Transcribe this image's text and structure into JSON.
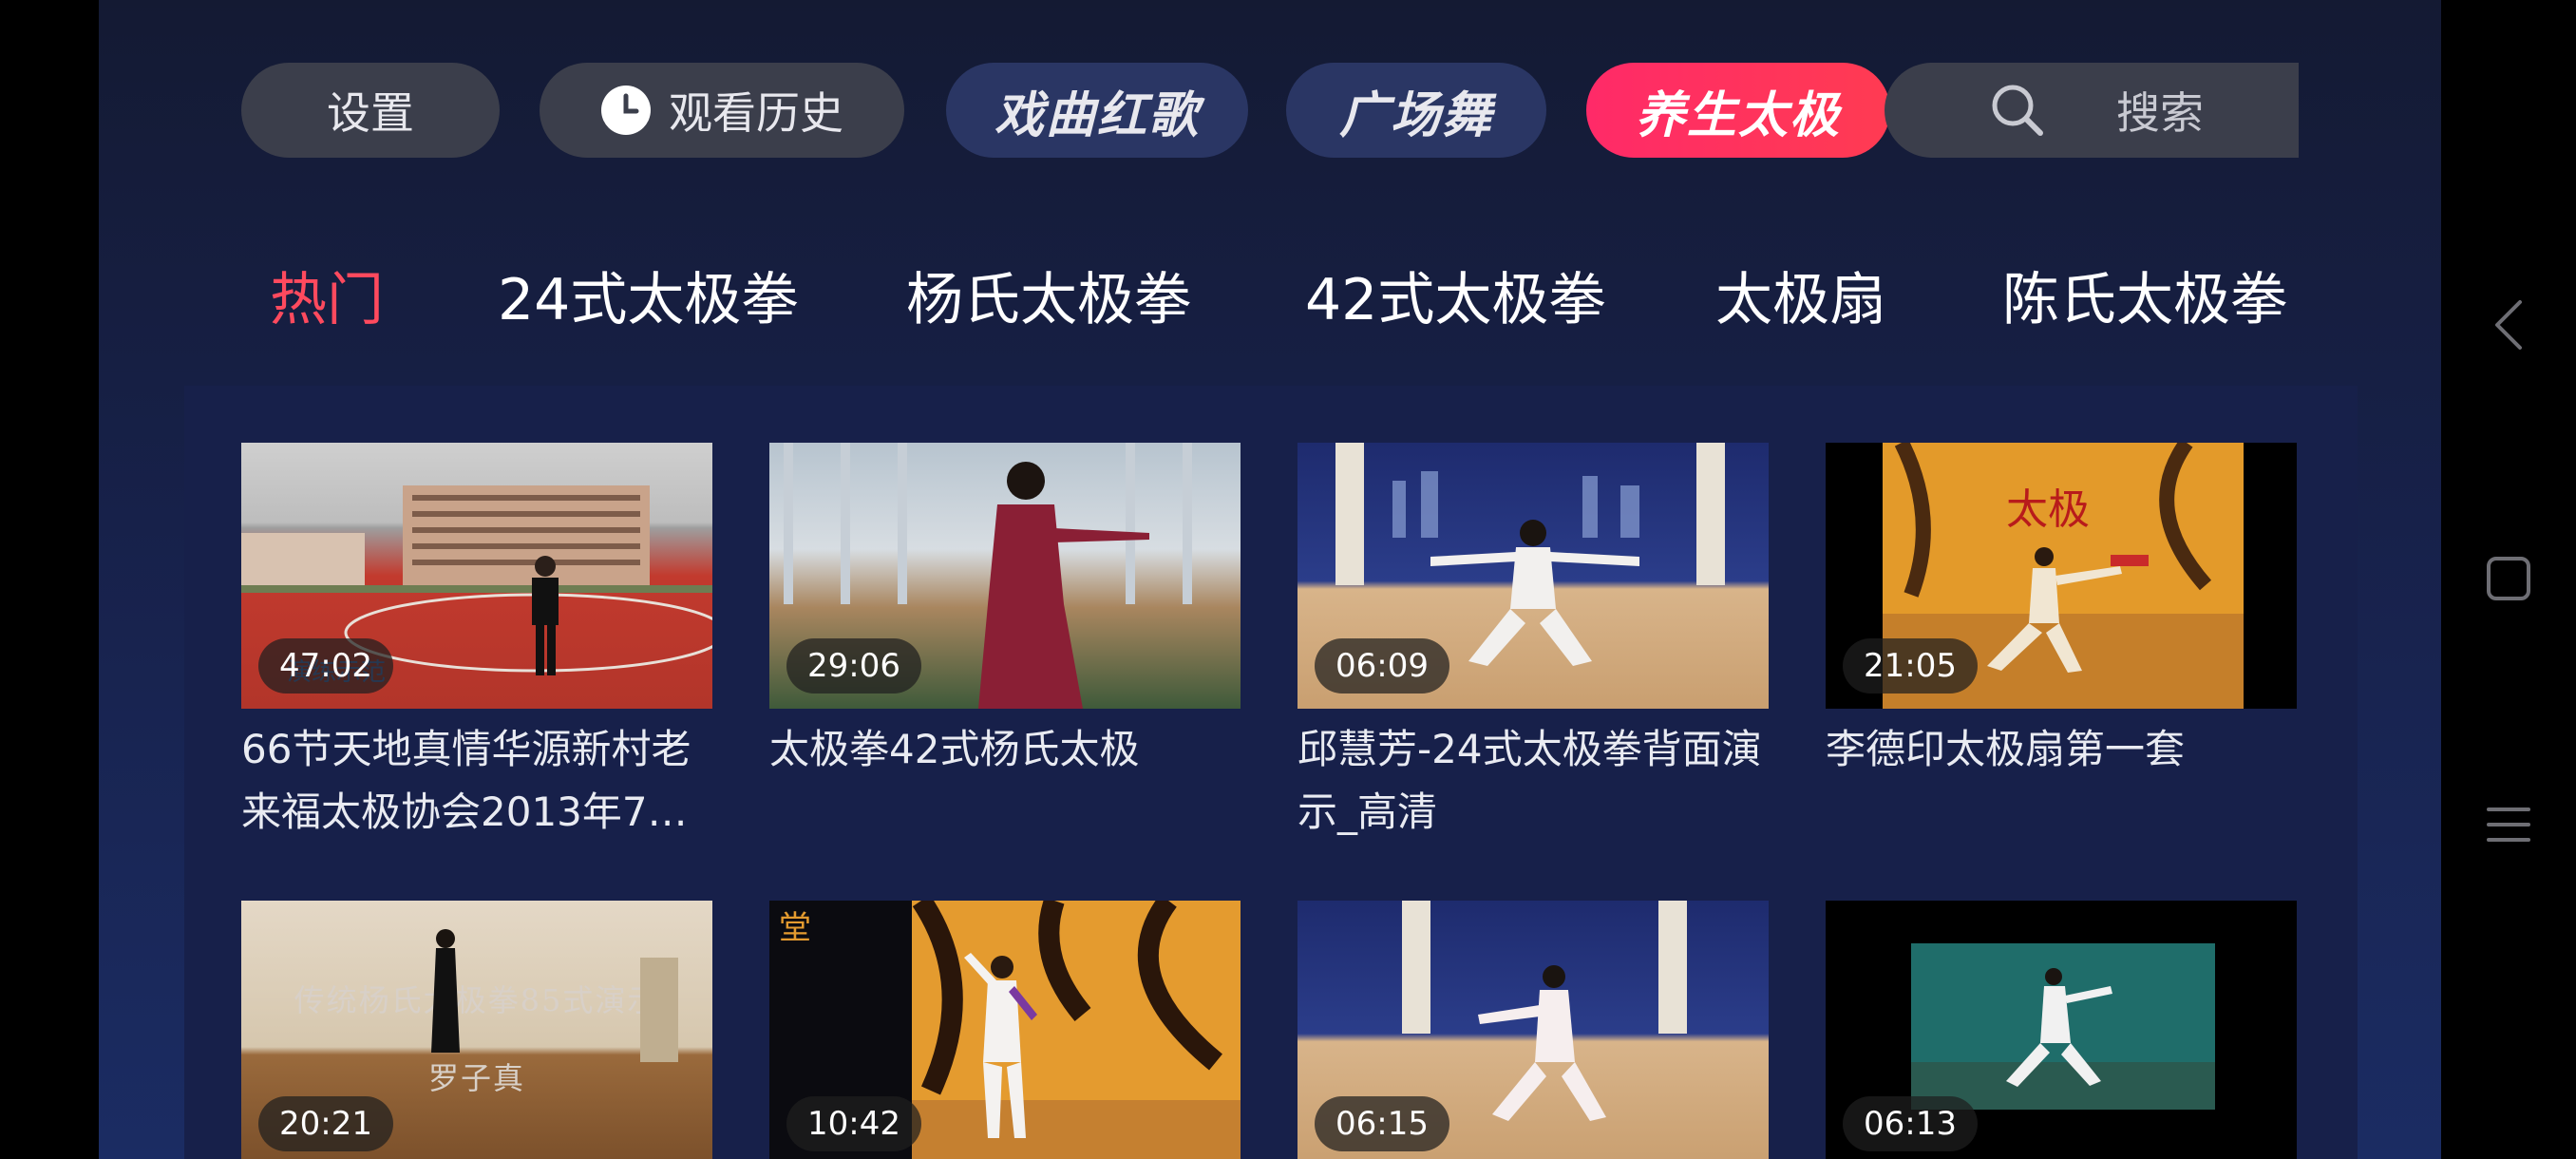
{
  "topbar": {
    "settings": "设置",
    "history": "观看历史",
    "opera": "戏曲红歌",
    "square_dance": "广场舞",
    "taiji": "养生太极",
    "search": "搜索"
  },
  "tabs": [
    {
      "label": "热门",
      "active": true
    },
    {
      "label": "24式太极拳",
      "active": false
    },
    {
      "label": "杨氏太极拳",
      "active": false
    },
    {
      "label": "42式太极拳",
      "active": false
    },
    {
      "label": "太极扇",
      "active": false
    },
    {
      "label": "陈氏太极拳",
      "active": false
    }
  ],
  "videos": [
    {
      "duration": "47:02",
      "title": "66节天地真情华源新村老来福太极协会2013年7…"
    },
    {
      "duration": "29:06",
      "title": "太极拳42式杨氏太极"
    },
    {
      "duration": "06:09",
      "title": "邱慧芳-24式太极拳背面演示_高清"
    },
    {
      "duration": "21:05",
      "title": "李德印太极扇第一套"
    },
    {
      "duration": "20:21",
      "title": ""
    },
    {
      "duration": "10:42",
      "title": ""
    },
    {
      "duration": "06:15",
      "title": ""
    },
    {
      "duration": "06:13",
      "title": ""
    }
  ],
  "thumb_text": {
    "t5_line1": "传统杨氏太极拳85式演示",
    "t5_line2": "罗子真"
  },
  "colors": {
    "accent": "#ff2a68",
    "active_tab": "#ff4a5e",
    "background": "#17204a"
  }
}
